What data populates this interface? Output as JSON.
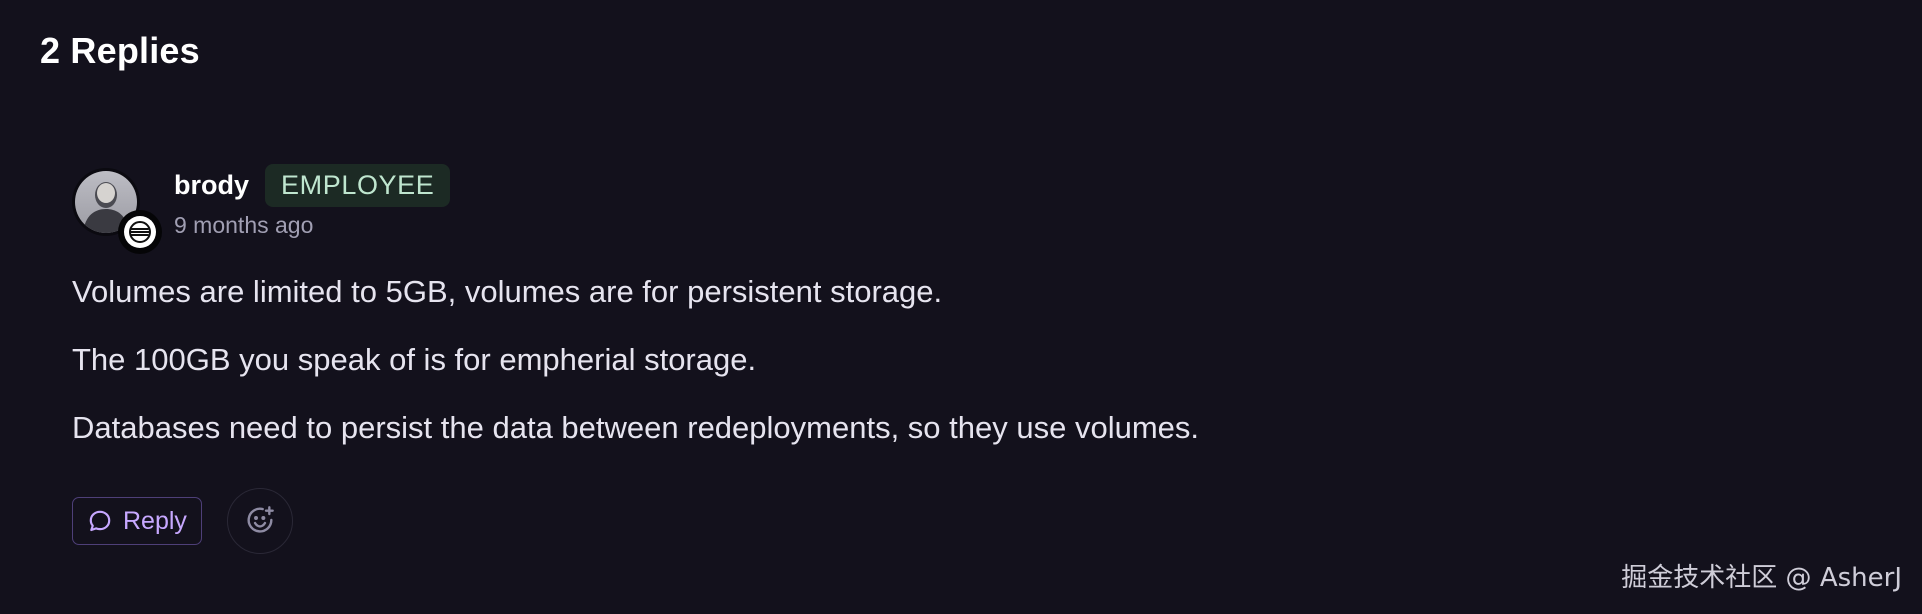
{
  "thread": {
    "replies_heading": "2 Replies"
  },
  "reply": {
    "author": {
      "username": "brody",
      "role": "EMPLOYEE",
      "avatar_icon": "user-avatar-icon",
      "badge_icon": "railway-logo-icon"
    },
    "timestamp": "9 months ago",
    "paragraphs": [
      "Volumes are limited to 5GB, volumes are for persistent storage.",
      "The 100GB you speak of is for empherial storage.",
      "Databases need to persist the data between redeployments, so they use volumes."
    ],
    "actions": {
      "reply_label": "Reply",
      "reply_icon": "chat-bubble-icon",
      "emoji_icon": "add-reaction-icon"
    }
  },
  "watermark": {
    "text": "掘金技术社区 @ AsherJ"
  },
  "colors": {
    "background": "#13111c",
    "role_badge_bg": "#1c2a24",
    "role_badge_text": "#bfe6cf",
    "reply_accent": "#c7a8ff",
    "reply_border": "#4e3f78"
  }
}
